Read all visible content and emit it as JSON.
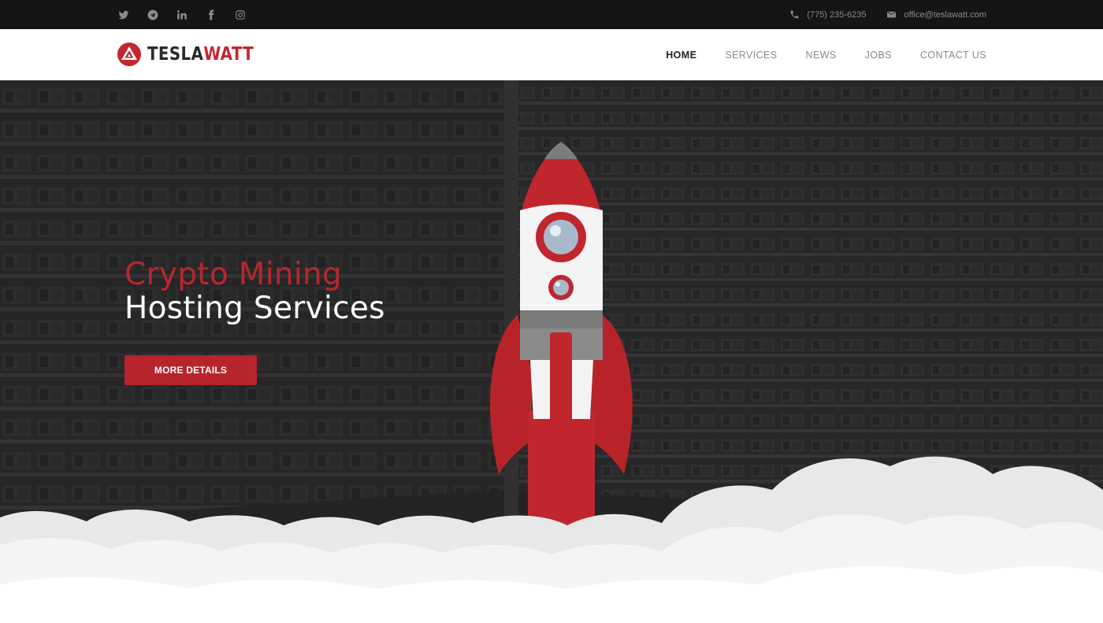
{
  "topbar": {
    "social": [
      {
        "icon": "twitter-icon"
      },
      {
        "icon": "telegram-icon"
      },
      {
        "icon": "linkedin-icon"
      },
      {
        "icon": "facebook-icon"
      },
      {
        "icon": "instagram-icon"
      }
    ],
    "phone": "(775) 235-6235",
    "email": "office@teslawatt.com"
  },
  "header": {
    "logo_part1": "TESLA",
    "logo_part2": "WATT",
    "nav": [
      {
        "label": "HOME",
        "active": true
      },
      {
        "label": "SERVICES",
        "active": false
      },
      {
        "label": "NEWS",
        "active": false
      },
      {
        "label": "JOBS",
        "active": false
      },
      {
        "label": "CONTACT US",
        "active": false
      }
    ]
  },
  "hero": {
    "title_line1": "Crypto Mining",
    "title_line2": "Hosting Services",
    "button_label": "MORE DETAILS"
  },
  "colors": {
    "brand_red": "#c4262e",
    "topbar_bg": "#151515",
    "hero_overlay": "#2b2b2b"
  }
}
